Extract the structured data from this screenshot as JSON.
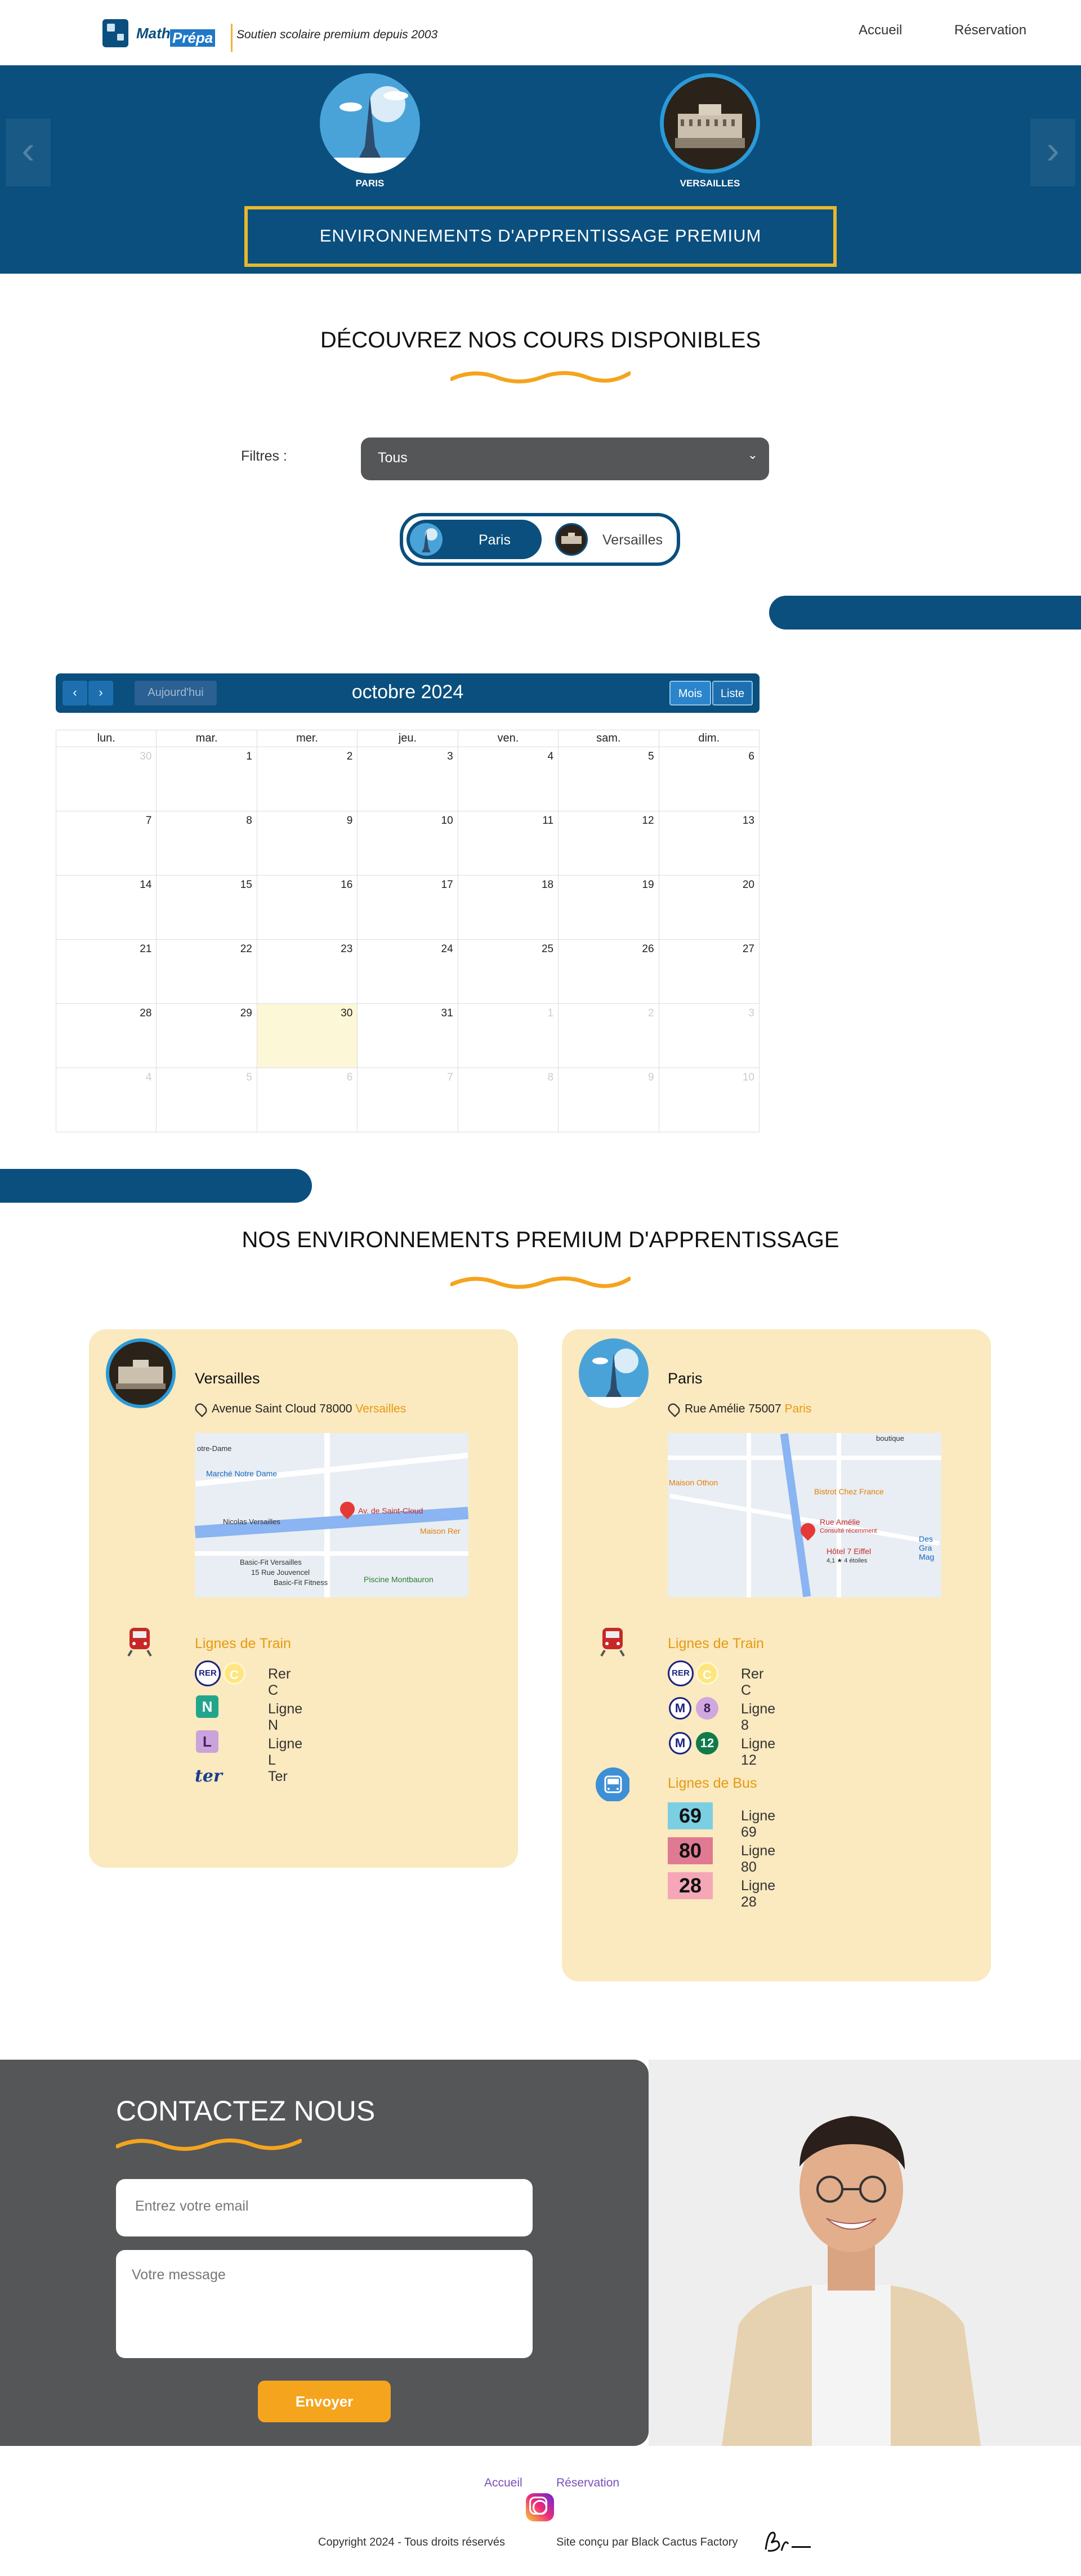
{
  "header": {
    "brand_a": "Math",
    "brand_b": "Prépa",
    "tagline": "Soutien scolaire premium depuis 2003",
    "nav": [
      "Accueil",
      "Réservation"
    ]
  },
  "hero": {
    "locations": [
      {
        "label": "PARIS"
      },
      {
        "label": "VERSAILLES"
      }
    ],
    "banner": "ENVIRONNEMENTS D'APPRENTISSAGE PREMIUM"
  },
  "courses": {
    "title": "DÉCOUVREZ NOS COURS DISPONIBLES",
    "filters_label": "Filtres :",
    "filter_value": "Tous",
    "toggle": {
      "paris": "Paris",
      "versailles": "Versailles"
    }
  },
  "calendar": {
    "today_label": "Aujourd'hui",
    "title": "octobre 2024",
    "view_month": "Mois",
    "view_list": "Liste",
    "weekdays": [
      "lun.",
      "mar.",
      "mer.",
      "jeu.",
      "ven.",
      "sam.",
      "dim."
    ],
    "weeks": [
      [
        "30",
        "1",
        "2",
        "3",
        "4",
        "5",
        "6"
      ],
      [
        "7",
        "8",
        "9",
        "10",
        "11",
        "12",
        "13"
      ],
      [
        "14",
        "15",
        "16",
        "17",
        "18",
        "19",
        "20"
      ],
      [
        "21",
        "22",
        "23",
        "24",
        "25",
        "26",
        "27"
      ],
      [
        "28",
        "29",
        "30",
        "31",
        "1",
        "2",
        "3"
      ],
      [
        "4",
        "5",
        "6",
        "7",
        "8",
        "9",
        "10"
      ]
    ]
  },
  "environments": {
    "title": "NOS ENVIRONNEMENTS PREMIUM D'APPRENTISSAGE",
    "cards": [
      {
        "name": "Versailles",
        "address": "Avenue Saint Cloud 78000",
        "city": "Versailles",
        "map_labels": [
          "Marché Notre Dame",
          "Av. de Saint-Cloud",
          "Maison Rer",
          "Nicolas Versailles",
          "Basic-Fit Versailles",
          "15 Rue Jouvencel",
          "Basic-Fit Fitness",
          "Piscine Montbauron",
          "otre-Dame"
        ],
        "train_title": "Lignes de Train",
        "train_lines": [
          {
            "badge_a": "RER",
            "badge_b": "C",
            "label": "Rer C"
          },
          {
            "badge_a": "N",
            "label": "Ligne N"
          },
          {
            "badge_a": "L",
            "label": "Ligne L"
          },
          {
            "badge_a": "ter",
            "label": "Ter"
          }
        ]
      },
      {
        "name": "Paris",
        "address": "Rue Amélie 75007",
        "city": "Paris",
        "map_labels": [
          "Maison Othon",
          "Bistrot Chez France",
          "Rue Amélie",
          "Consulté récemment",
          "Hôtel 7 Eiffel",
          "4,1 ★ 4 étoiles",
          "Des Gra Mag",
          "boutique"
        ],
        "train_title": "Lignes de Train",
        "train_lines": [
          {
            "badge_a": "RER",
            "badge_b": "C",
            "label": "Rer C"
          },
          {
            "badge_a": "M",
            "badge_b": "8",
            "label": "Ligne 8"
          },
          {
            "badge_a": "M",
            "badge_b": "12",
            "label": "Ligne 12"
          }
        ],
        "bus_title": "Lignes de Bus",
        "bus_lines": [
          {
            "badge": "69",
            "label": "Ligne 69"
          },
          {
            "badge": "80",
            "label": "Ligne 80"
          },
          {
            "badge": "28",
            "label": "Ligne 28"
          }
        ]
      }
    ]
  },
  "contact": {
    "title": "CONTACTEZ NOUS",
    "email_placeholder": "Entrez votre email",
    "message_placeholder": "Votre message",
    "send": "Envoyer"
  },
  "footer": {
    "links": [
      "Accueil",
      "Réservation"
    ],
    "copyright": "Copyright 2024 - Tous droits réservés",
    "credit": "Site conçu par Black Cactus Factory"
  },
  "colors": {
    "primary": "#0a4f7e",
    "accent": "#f5a41d",
    "card": "#fbe9bf",
    "contact_bg": "#545658"
  }
}
